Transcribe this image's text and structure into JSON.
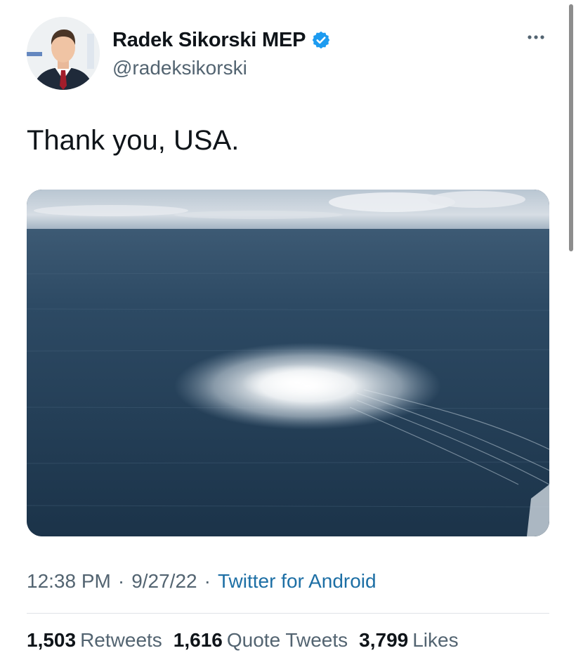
{
  "author": {
    "display_name": "Radek Sikorski MEP",
    "handle": "@radeksikorski",
    "verified": true,
    "avatar_icon": "person-avatar"
  },
  "tweet": {
    "text": "Thank you, USA.",
    "media": {
      "kind": "photo",
      "alt": ""
    }
  },
  "meta": {
    "time": "12:38 PM",
    "separator": "·",
    "date": "9/27/22",
    "source": "Twitter for Android"
  },
  "stats": [
    {
      "count": "1,503",
      "label": "Retweets"
    },
    {
      "count": "1,616",
      "label": "Quote Tweets"
    },
    {
      "count": "3,799",
      "label": "Likes"
    }
  ],
  "icons": {
    "more": "more-horizontal-icon",
    "verified": "verified-badge-icon"
  },
  "colors": {
    "verified_blue": "#1d9bf0",
    "link_blue": "#1d6fa5",
    "secondary_text": "#536471"
  }
}
